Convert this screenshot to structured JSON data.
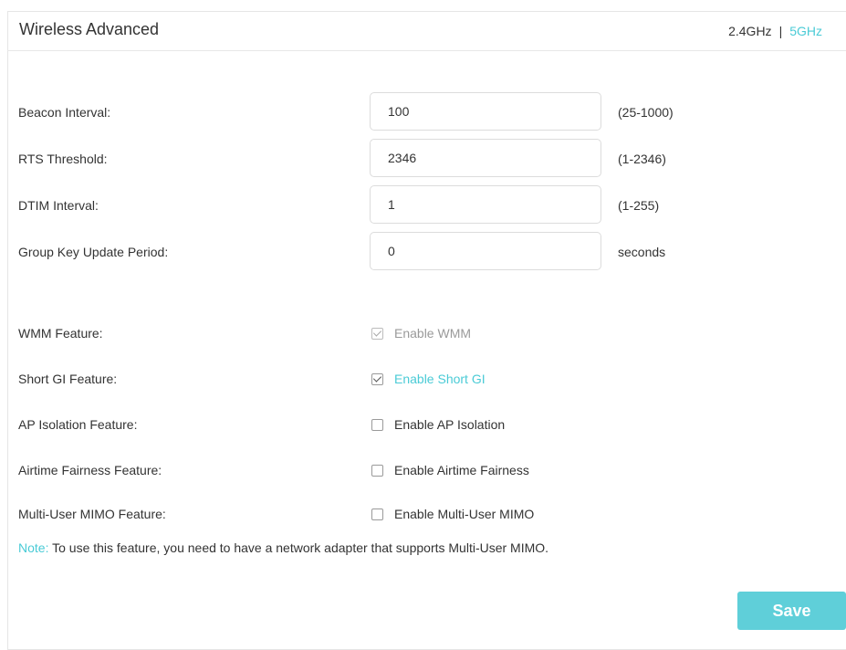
{
  "header": {
    "title": "Wireless Advanced",
    "bands": {
      "band_24": "2.4GHz",
      "separator": "|",
      "band_5": "5GHz",
      "active": "5GHz"
    }
  },
  "fields": {
    "beacon_interval": {
      "label": "Beacon Interval:",
      "value": "100",
      "hint": "(25-1000)"
    },
    "rts_threshold": {
      "label": "RTS Threshold:",
      "value": "2346",
      "hint": "(1-2346)"
    },
    "dtim_interval": {
      "label": "DTIM Interval:",
      "value": "1",
      "hint": "(1-255)"
    },
    "group_key": {
      "label": "Group Key Update Period:",
      "value": "0",
      "hint": "seconds"
    }
  },
  "features": {
    "wmm": {
      "label": "WMM Feature:",
      "option": "Enable WMM",
      "checked": true,
      "disabled": true
    },
    "short_gi": {
      "label": "Short GI Feature:",
      "option": "Enable Short GI",
      "checked": true,
      "disabled": false
    },
    "ap_isolation": {
      "label": "AP Isolation Feature:",
      "option": "Enable AP Isolation",
      "checked": false,
      "disabled": false
    },
    "airtime": {
      "label": "Airtime Fairness Feature:",
      "option": "Enable Airtime Fairness",
      "checked": false,
      "disabled": false
    },
    "mu_mimo": {
      "label": "Multi-User MIMO Feature:",
      "option": "Enable Multi-User MIMO",
      "checked": false,
      "disabled": false
    }
  },
  "note": {
    "label": "Note:",
    "text": " To use this feature, you need to have a network adapter that supports Multi-User MIMO."
  },
  "actions": {
    "save_label": "Save"
  },
  "colors": {
    "accent": "#4acbd6",
    "button": "#5fcfd9"
  }
}
